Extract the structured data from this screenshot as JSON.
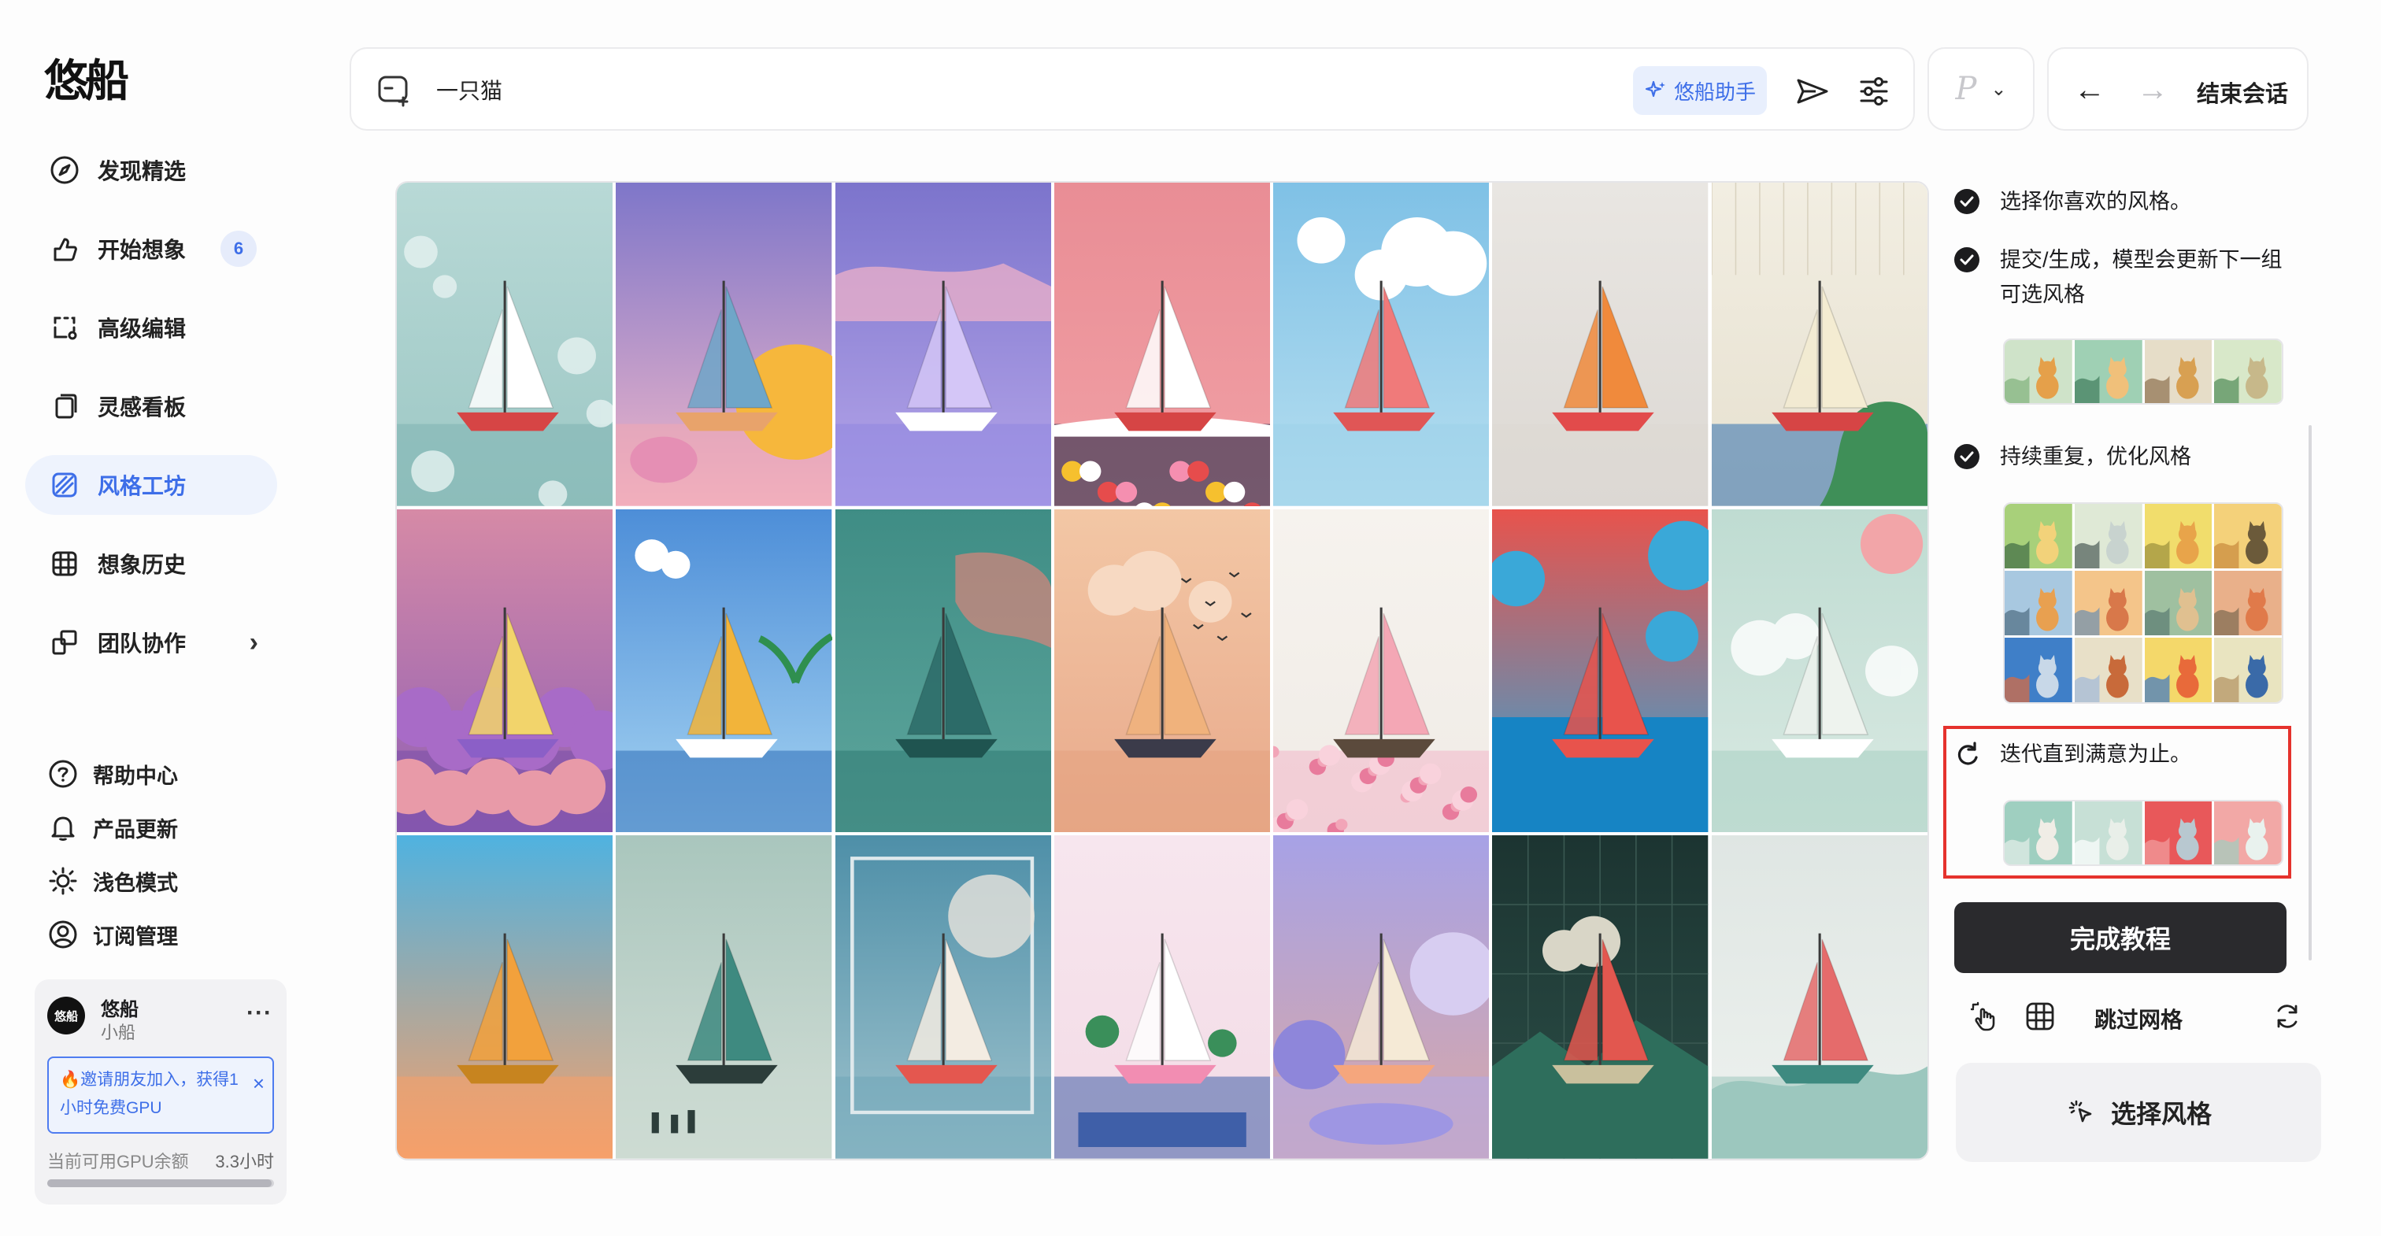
{
  "app": {
    "logo_text": "悠船"
  },
  "sidebar": {
    "nav": [
      {
        "label": "发现精选",
        "icon": "compass-icon"
      },
      {
        "label": "开始想象",
        "icon": "thumb-brush-icon",
        "badge": "6"
      },
      {
        "label": "高级编辑",
        "icon": "edit-crop-icon"
      },
      {
        "label": "灵感看板",
        "icon": "board-icon"
      },
      {
        "label": "风格工坊",
        "icon": "style-pattern-icon",
        "active": true
      },
      {
        "label": "想象历史",
        "icon": "grid-icon"
      },
      {
        "label": "团队协作",
        "icon": "team-icon",
        "chevron": "›"
      }
    ],
    "bottom": [
      {
        "label": "帮助中心",
        "icon": "help-icon"
      },
      {
        "label": "产品更新",
        "icon": "bell-icon"
      },
      {
        "label": "浅色模式",
        "icon": "sun-icon"
      },
      {
        "label": "订阅管理",
        "icon": "user-circle-icon"
      }
    ],
    "user": {
      "avatar_text": "悠船",
      "name": "悠船",
      "subtitle": "小船",
      "more": "···",
      "invite_text": "🔥邀请朋友加入，获得1小时免费GPU",
      "invite_close": "×",
      "gpu_label": "当前可用GPU余额",
      "gpu_value": "3.3小时",
      "gpu_fraction": 0.99
    }
  },
  "topbar": {
    "prompt_value": "一只猫",
    "assistant_label": "悠船助手",
    "model_letter": "P",
    "model_chevron": "⌄",
    "back_arrow": "←",
    "forward_arrow": "→",
    "end_session_label": "结束会话"
  },
  "grid": {
    "tiles": [
      {
        "bg": [
          "#b8d9d6",
          "#9cc7c4"
        ],
        "sea": "#7fb4b3",
        "sail": "#ffffff",
        "hull": "#d64545",
        "style": "ice"
      },
      {
        "bg": [
          "#7e76c9",
          "#f1b7c9"
        ],
        "sea": "#f2a7b0",
        "sail": "#6fa6c8",
        "hull": "#e8a36b",
        "style": "sun"
      },
      {
        "bg": [
          "#7c74cc",
          "#b6a6ea"
        ],
        "sea": "#8f86e0",
        "sail": "#d4c6f7",
        "hull": "#ffffff",
        "style": "glass"
      },
      {
        "bg": [
          "#e98d95",
          "#f1a0a5"
        ],
        "sea": "#0e1d3f",
        "sail": "#ffffff",
        "hull": "#d64545",
        "style": "flowers"
      },
      {
        "bg": [
          "#7fc1e6",
          "#b7dff0"
        ],
        "sea": "#9dd1e9",
        "sail": "#f07a7a",
        "hull": "#e05656",
        "style": "cloud"
      },
      {
        "bg": [
          "#e9e6e2",
          "#dcd8d3"
        ],
        "sea": "#dcd8d3",
        "sail": "#f08a3c",
        "hull": "#e24b4b",
        "style": "sculpt"
      },
      {
        "bg": [
          "#f2eee2",
          "#e6e0cf"
        ],
        "sea": "#2f6fae",
        "sail": "#f4ecd2",
        "hull": "#d64545",
        "style": "map"
      },
      {
        "bg": [
          "#d68aa6",
          "#8f5fb5"
        ],
        "sea": "#7a4fa8",
        "sail": "#f2d46b",
        "hull": "#8b5fc7",
        "style": "coral"
      },
      {
        "bg": [
          "#4d8ed8",
          "#a6d4f2"
        ],
        "sea": "#2e6db8",
        "sail": "#f2b43a",
        "hull": "#ffffff",
        "style": "tropic"
      },
      {
        "bg": [
          "#3f8d85",
          "#5ea69d"
        ],
        "sea": "#2f7a72",
        "sail": "#2c6b68",
        "hull": "#1f5450",
        "style": "teal"
      },
      {
        "bg": [
          "#f3c7a5",
          "#e8a98b"
        ],
        "sea": "#e3a27f",
        "sail": "#f0b27c",
        "hull": "#3b3b4a",
        "style": "dusk"
      },
      {
        "bg": [
          "#f6f3ee",
          "#f0ebe6"
        ],
        "sea": "#f2b7c8",
        "sail": "#f4a7b5",
        "hull": "#5b4a3c",
        "style": "petals"
      },
      {
        "bg": [
          "#e8534c",
          "#2fa6d9"
        ],
        "sea": "#1a8ec8",
        "sail": "#e8534c",
        "hull": "#e8534c",
        "style": "red"
      },
      {
        "bg": [
          "#bfdcd2",
          "#d9e9e2"
        ],
        "sea": "#a8cfc3",
        "sail": "#eef3ee",
        "hull": "#ffffff",
        "style": "mint"
      },
      {
        "bg": [
          "#4fb2e0",
          "#f6a06a"
        ],
        "sea": "#f6a06a",
        "sail": "#f2a13c",
        "hull": "#c7841f",
        "style": "gradient"
      },
      {
        "bg": [
          "#a9c6bd",
          "#d3ded6"
        ],
        "sea": "#c9d8d0",
        "sail": "#3e8a80",
        "hull": "#2c3d3a",
        "style": "boat"
      },
      {
        "bg": [
          "#4e8fa8",
          "#9fc3cd"
        ],
        "sea": "#6fa6b8",
        "sail": "#f3ece2",
        "hull": "#e4574f",
        "style": "frame"
      },
      {
        "bg": [
          "#f7e6ee",
          "#f3dbe6"
        ],
        "sea": "#3f5fa8",
        "sail": "#ffffff",
        "hull": "#f28db2",
        "style": "collage"
      },
      {
        "bg": [
          "#a7a2e6",
          "#d9a7a6"
        ],
        "sea": "#b1a9ea",
        "sail": "#f5ead6",
        "hull": "#f5a67d",
        "style": "pastel3d"
      },
      {
        "bg": [
          "#1c3431",
          "#2b4e47"
        ],
        "sea": "#2a7d69",
        "sail": "#e2574f",
        "hull": "#c9c09d",
        "style": "dark"
      },
      {
        "bg": [
          "#dfe6e3",
          "#eef2ef"
        ],
        "sea": "#9cc7be",
        "sail": "#e56b6b",
        "hull": "#3e8a80",
        "style": "sketch"
      }
    ]
  },
  "panel": {
    "steps": [
      {
        "text": "选择你喜欢的风格。",
        "state": "done"
      },
      {
        "text": "提交/生成，模型会更新下一组可选风格",
        "state": "done"
      },
      {
        "text": "持续重复，优化风格",
        "state": "done"
      },
      {
        "text": "迭代直到满意为止。",
        "state": "current"
      }
    ],
    "finish_label": "完成教程",
    "skip_label": "跳过网格",
    "choose_style_label": "选择风格",
    "accent": "#e5322d"
  }
}
